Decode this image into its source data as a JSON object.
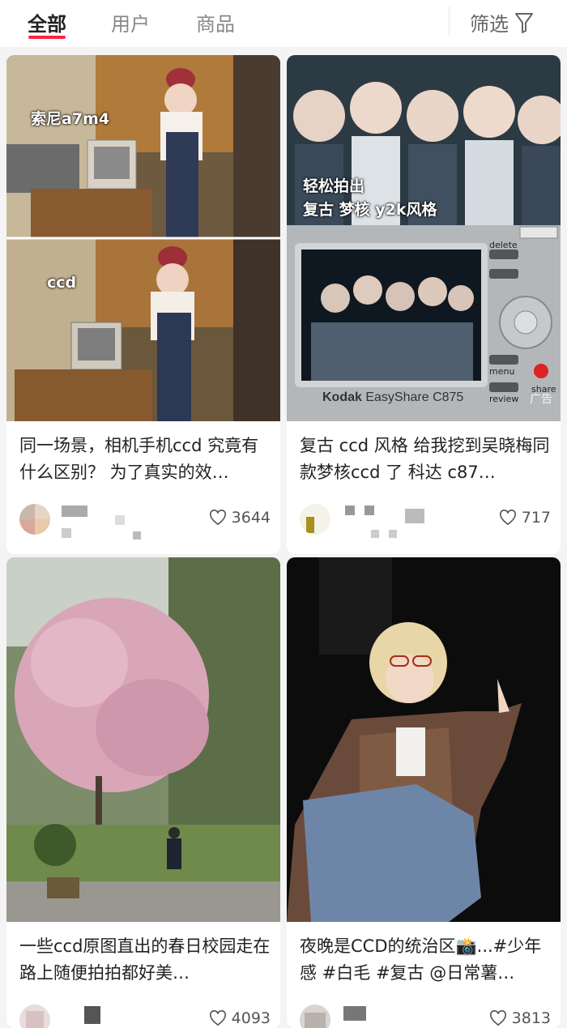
{
  "tabs": {
    "all": "全部",
    "users": "用户",
    "goods": "商品",
    "filter": "筛选"
  },
  "cards": [
    {
      "title": "同一场景，相机手机ccd 究竟有什么区别？ 为了真实的效…",
      "likes": "3644",
      "image": {
        "label_top": "索尼a7m4",
        "label_bottom": "ccd"
      }
    },
    {
      "title": "复古 ccd 风格 给我挖到吴晓梅同款梦核ccd 了 科达 c87…",
      "likes": "717",
      "image": {
        "caption_line1": "轻松拍出",
        "caption_line2": "复古 梦核 y2k风格",
        "camera_brand": "Kodak",
        "camera_model": "EasyShare C875",
        "btn_delete": "delete",
        "btn_menu": "menu",
        "btn_review": "review",
        "btn_share": "share",
        "ad": "广告"
      }
    },
    {
      "title": "一些ccd原图直出的春日校园走在路上随便拍拍都好美…",
      "likes": "4093"
    },
    {
      "title": "夜晚是CCD的统治区📸...#少年感 #白毛 #复古 @日常薯…",
      "likes": "3813"
    }
  ],
  "colors": {
    "accent": "#ff2442"
  }
}
